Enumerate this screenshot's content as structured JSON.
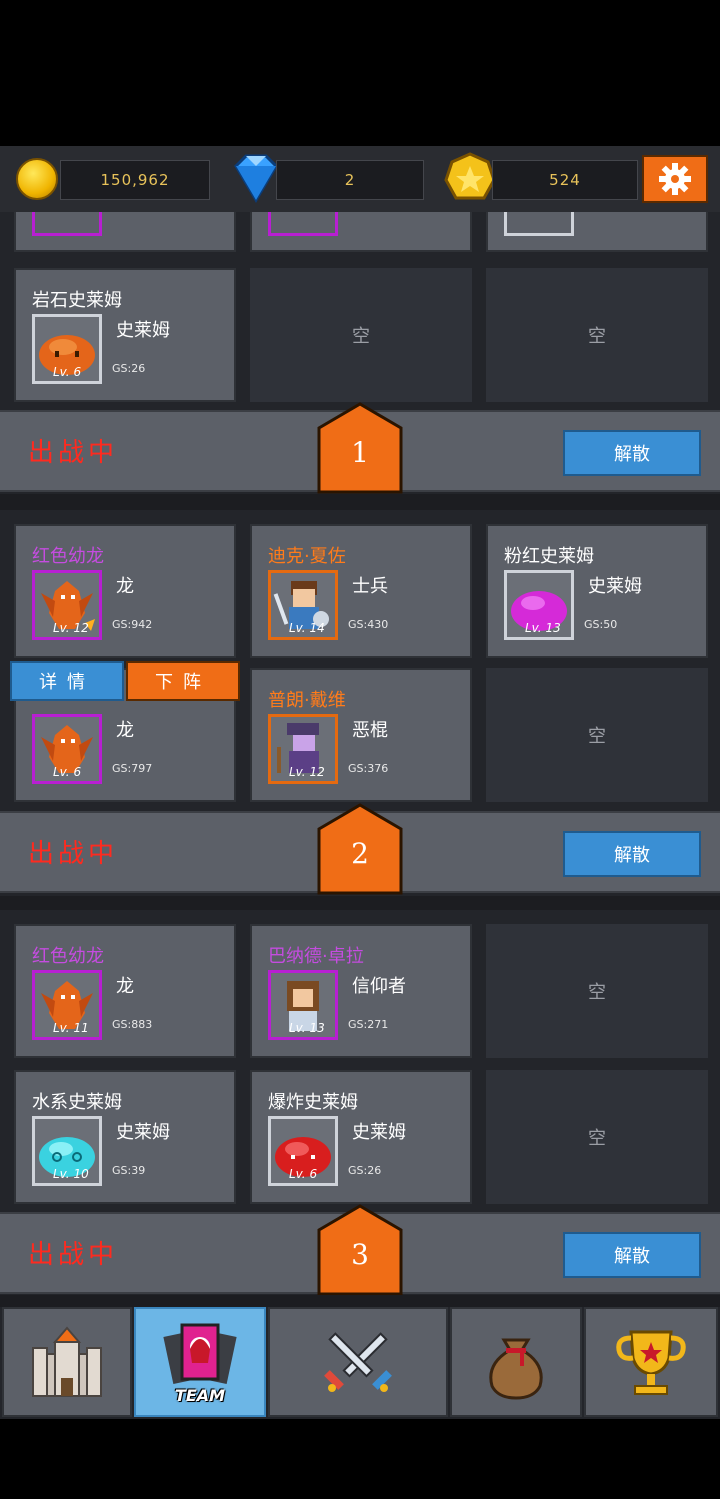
{
  "header": {
    "gold": "150,962",
    "gems": "2",
    "medals": "524",
    "settings_icon": "gear-icon"
  },
  "team1_partial": {
    "cards": [
      {
        "name": "岩石史莱姆",
        "class": "史莱姆",
        "level": "Lv. 6",
        "gs": "GS:26"
      },
      {
        "empty": "空"
      },
      {
        "empty": "空"
      }
    ],
    "status": "出战中",
    "number": "1",
    "disband": "解散"
  },
  "team2": {
    "cards": [
      {
        "name": "红色幼龙",
        "class": "龙",
        "level": "Lv. 12",
        "gs": "GS:942"
      },
      {
        "name": "迪克·夏佐",
        "class": "士兵",
        "level": "Lv. 14",
        "gs": "GS:430"
      },
      {
        "name": "粉红史莱姆",
        "class": "史莱姆",
        "level": "Lv. 13",
        "gs": "GS:50"
      },
      {
        "class": "龙",
        "level": "Lv. 6",
        "gs": "GS:797"
      },
      {
        "name": "普朗·戴维",
        "class": "恶棍",
        "level": "Lv. 12",
        "gs": "GS:376"
      },
      {
        "empty": "空"
      }
    ],
    "popup": {
      "details": "详情",
      "demote": "下阵"
    },
    "status": "出战中",
    "number": "2",
    "disband": "解散"
  },
  "team3": {
    "cards": [
      {
        "name": "红色幼龙",
        "class": "龙",
        "level": "Lv. 11",
        "gs": "GS:883"
      },
      {
        "name": "巴纳德·卓拉",
        "class": "信仰者",
        "level": "Lv. 13",
        "gs": "GS:271"
      },
      {
        "empty": "空"
      },
      {
        "name": "水系史莱姆",
        "class": "史莱姆",
        "level": "Lv. 10",
        "gs": "GS:39"
      },
      {
        "name": "爆炸史莱姆",
        "class": "史莱姆",
        "level": "Lv. 6",
        "gs": "GS:26"
      },
      {
        "empty": "空"
      }
    ],
    "status": "出战中",
    "number": "3",
    "disband": "解散"
  },
  "nav": {
    "team_label": "TEAM"
  },
  "colors": {
    "accent_orange": "#f06d16",
    "blue_button": "#3a8fd4",
    "status_red": "#ff2a1f",
    "rare_purple": "#c54ce0"
  }
}
